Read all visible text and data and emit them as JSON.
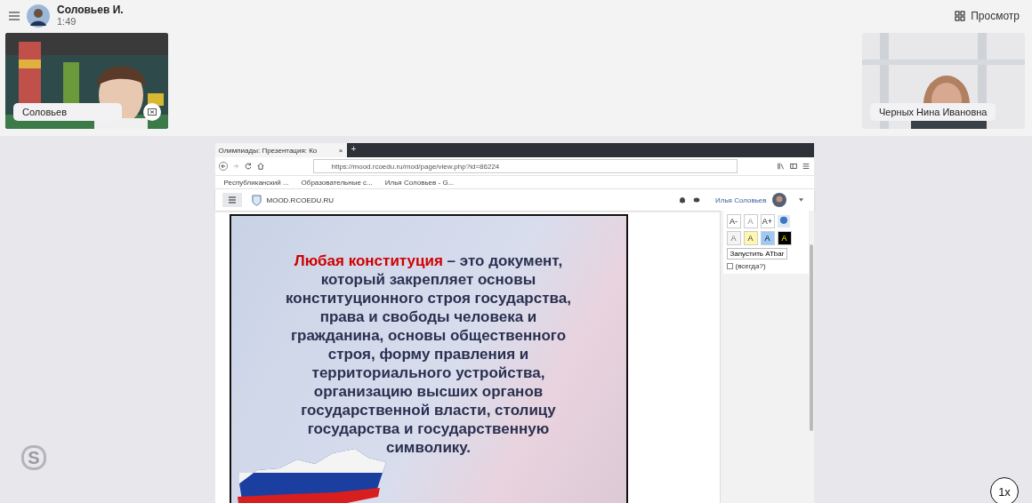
{
  "call_header": {
    "name": "Соловьев И.",
    "duration": "1:49",
    "view_button": "Просмотр"
  },
  "participants": [
    {
      "name": "Соловьев",
      "kind": "picture",
      "muted": true
    },
    {
      "name": "Черных Нина Ивановна",
      "kind": "picture",
      "muted": false
    }
  ],
  "shared_screen": {
    "tab_title": "Олимпиады: Презентация: Ко",
    "tab_close": "×",
    "new_tab": "+",
    "url": "https://mood.rcoedu.ru/mod/page/view.php?id=86224",
    "bookmarks": [
      "Республиканский ...",
      "Образовательные с...",
      "Илья Соловьев - G..."
    ],
    "site_name": "MOOD.RCOEDU.RU",
    "user_name": "Илья Соловьев",
    "atbar": {
      "buttons": [
        "A-",
        "A",
        "A+"
      ],
      "colors": [
        "A",
        "A",
        "A",
        "A"
      ],
      "launch": "Запустить ATbar",
      "always": "(всегда?)",
      "always_checked": false
    },
    "slide_text": "**Любая конституция** – это документ, который закрепляет основы конституционного строя государства, права и свободы человека и гражданина, основы общественного строя, форму правления и территориального устройства, организацию высших органов государственной власти, столицу государства и государственную символику."
  },
  "skype_logo": "S",
  "speed": "1x"
}
